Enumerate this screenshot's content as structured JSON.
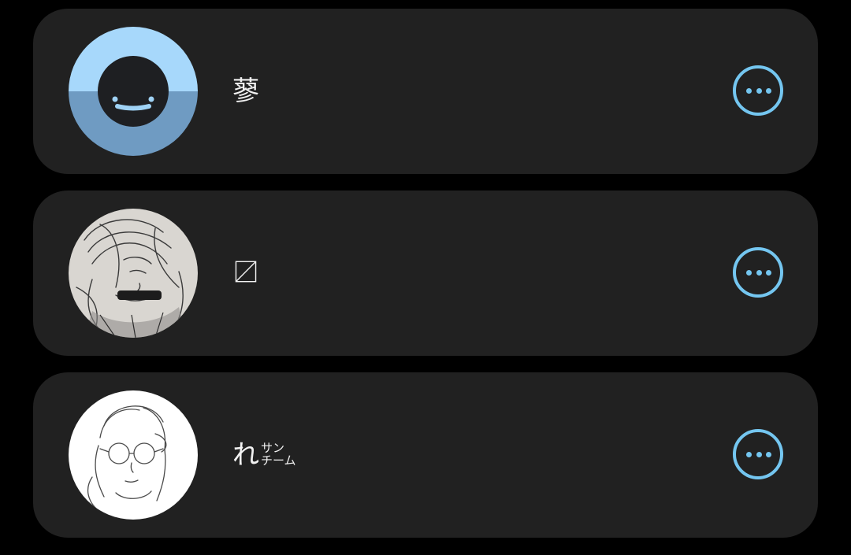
{
  "contacts": [
    {
      "name": "蓼",
      "ruby": [],
      "avatar": "blue-smiley-avatar",
      "menu_icon": "more-options-icon"
    },
    {
      "name": "〼",
      "ruby": [],
      "avatar": "sketch-girl-avatar",
      "menu_icon": "more-options-icon"
    },
    {
      "name": "れ",
      "ruby": [
        "サン",
        "チーム"
      ],
      "avatar": "sketch-glasses-avatar",
      "menu_icon": "more-options-icon"
    }
  ],
  "colors": {
    "background": "#000000",
    "card": "#212121",
    "accent": "#74c6f0",
    "text": "#f2f2f2",
    "avatar_light_blue": "#a7d8fb",
    "avatar_dark_blue": "#6f9bc2"
  }
}
